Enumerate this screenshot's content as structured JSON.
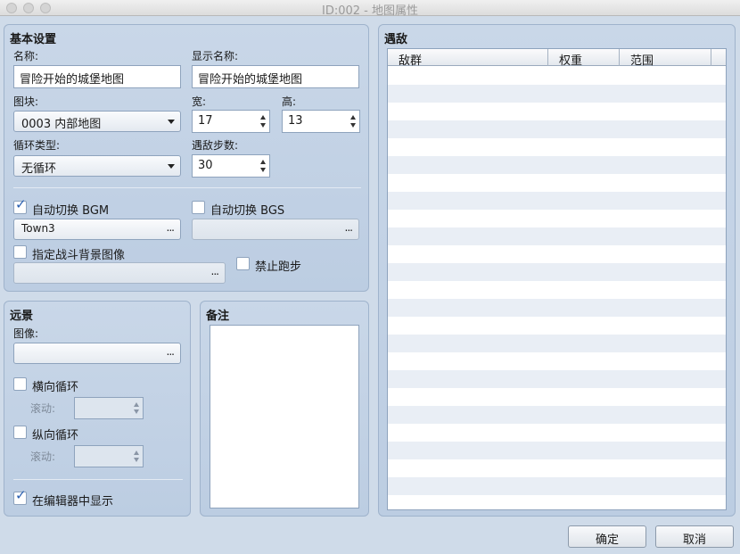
{
  "window": {
    "title": "ID:002 - 地图属性"
  },
  "basic": {
    "group_title": "基本设置",
    "name_label": "名称:",
    "name_value": "冒险开始的城堡地图",
    "display_name_label": "显示名称:",
    "display_name_value": "冒险开始的城堡地图",
    "tileset_label": "图块:",
    "tileset_value": "0003 内部地图",
    "width_label": "宽:",
    "width_value": "17",
    "height_label": "高:",
    "height_value": "13",
    "scroll_type_label": "循环类型:",
    "scroll_type_value": "无循环",
    "encounter_steps_label": "遇敌步数:",
    "encounter_steps_value": "30",
    "autoplay_bgm_label": "自动切换 BGM",
    "autoplay_bgm_checked": true,
    "bgm_value": "Town3",
    "autoplay_bgs_label": "自动切换 BGS",
    "autoplay_bgs_checked": false,
    "bgs_value": "",
    "battleback_label": "指定战斗背景图像",
    "battleback_checked": false,
    "battleback_value": "",
    "disable_dash_label": "禁止跑步",
    "disable_dash_checked": false,
    "dots": "..."
  },
  "parallax": {
    "group_title": "远景",
    "image_label": "图像:",
    "image_value": "",
    "loop_h_label": "横向循环",
    "loop_h_checked": false,
    "scroll_h_label": "滚动:",
    "scroll_h_value": "",
    "loop_v_label": "纵向循环",
    "loop_v_checked": false,
    "scroll_v_label": "滚动:",
    "scroll_v_value": "",
    "show_in_editor_label": "在编辑器中显示",
    "show_in_editor_checked": true
  },
  "note": {
    "group_title": "备注",
    "value": ""
  },
  "encounters": {
    "group_title": "遇敌",
    "columns": [
      "敌群",
      "权重",
      "范围"
    ],
    "rows": []
  },
  "buttons": {
    "ok": "确定",
    "cancel": "取消"
  },
  "colors": {
    "accent": "#2a5fb0",
    "panel": "#c9d7e8",
    "background": "#cfdbe9"
  }
}
